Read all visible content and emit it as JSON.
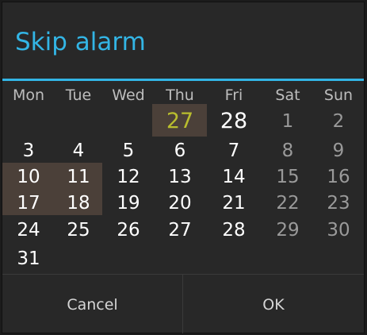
{
  "dialog": {
    "title": "Skip alarm",
    "buttons": {
      "cancel": "Cancel",
      "ok": "OK"
    }
  },
  "calendar": {
    "weekdays": [
      "Mon",
      "Tue",
      "Wed",
      "Thu",
      "Fri",
      "Sat",
      "Sun"
    ],
    "weeks": [
      [
        "",
        "",
        "",
        "27",
        "28",
        "1",
        "2"
      ],
      [
        "3",
        "4",
        "5",
        "6",
        "7",
        "8",
        "9"
      ],
      [
        "10",
        "11",
        "12",
        "13",
        "14",
        "15",
        "16"
      ],
      [
        "17",
        "18",
        "19",
        "20",
        "21",
        "22",
        "23"
      ],
      [
        "24",
        "25",
        "26",
        "27",
        "28",
        "29",
        "30"
      ],
      [
        "31",
        "",
        "",
        "",
        "",
        "",
        ""
      ]
    ],
    "today": "27",
    "selected_skip_days": [
      "27",
      "10",
      "11",
      "17",
      "18"
    ]
  },
  "colors": {
    "accent": "#33b5e5",
    "today_text": "#b9bd2e",
    "skip_highlight": "#4b4039",
    "weekday_text": "#ffffff",
    "weekend_text": "#9a9a9a"
  }
}
